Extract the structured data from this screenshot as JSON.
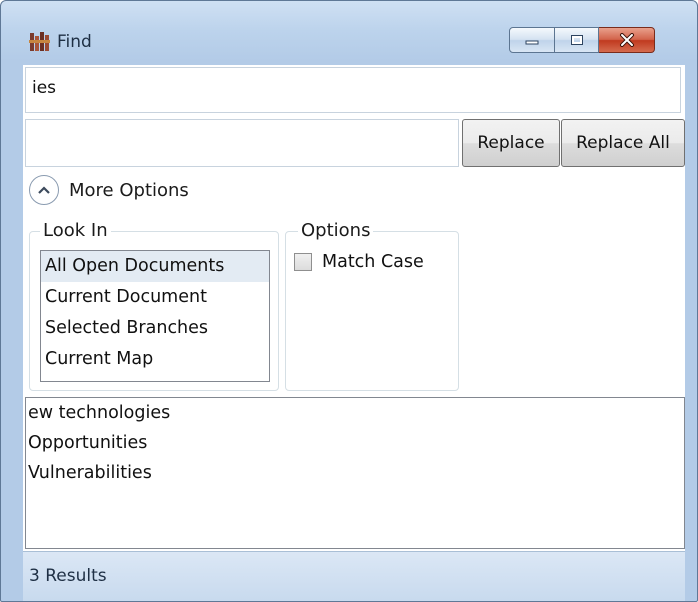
{
  "window": {
    "title": "Find",
    "icon": "find-app-icon",
    "controls": [
      "minimize-icon",
      "maximize-icon",
      "close-icon"
    ]
  },
  "find": {
    "value": "ies"
  },
  "replace": {
    "value": "",
    "replace_label": "Replace",
    "replace_all_label": "Replace All"
  },
  "more_options": {
    "label": "More Options",
    "icon": "chevron-up-icon"
  },
  "look_in": {
    "legend": "Look In",
    "items": [
      "All Open Documents",
      "Current Document",
      "Selected Branches",
      "Current Map"
    ],
    "selected": "All Open Documents"
  },
  "options": {
    "legend": "Options",
    "match_case_label": "Match Case",
    "match_case_checked": false
  },
  "results": {
    "items": [
      "ew technologies",
      "Opportunities",
      "Vulnerabilities"
    ]
  },
  "status": {
    "text": "3 Results"
  },
  "colors": {
    "titlebar": "#bcd3ec",
    "close_button": "#c0391f",
    "selection": "#e3ebf3"
  }
}
